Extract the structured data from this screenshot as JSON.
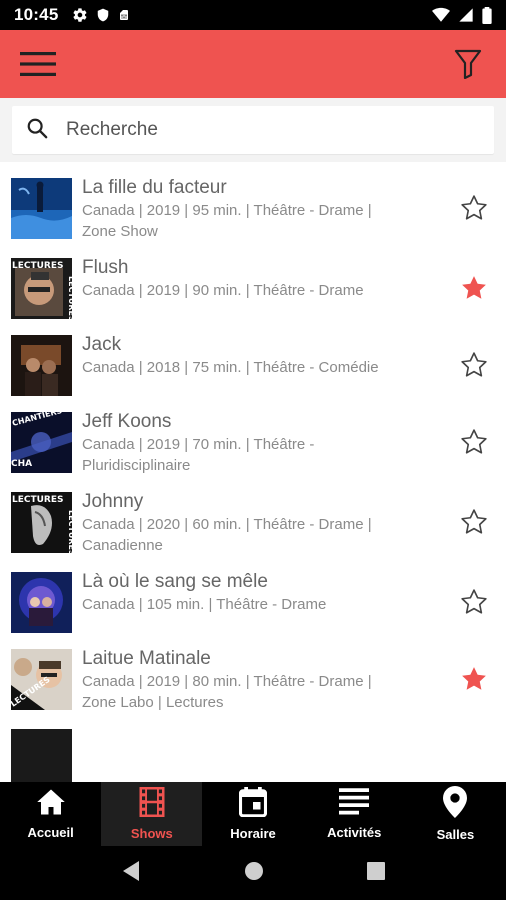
{
  "status_bar": {
    "time": "10:45",
    "left_icons": [
      "gear-icon",
      "shield-icon",
      "sim-card-icon"
    ],
    "right_icons": [
      "wifi-icon",
      "signal-icon",
      "battery-icon"
    ]
  },
  "app_bar": {
    "color": "#ef5350",
    "menu_icon": "hamburger-menu-icon",
    "filter_icon": "filter-icon"
  },
  "search": {
    "placeholder": "Recherche"
  },
  "shows": [
    {
      "title": "La fille du facteur",
      "meta_lines": [
        "Canada | 2019 | 95 min. | Théâtre - Drame |",
        "Zone Show"
      ],
      "favorite": false
    },
    {
      "title": "Flush",
      "meta_lines": [
        "Canada | 2019 | 90 min. | Théâtre - Drame"
      ],
      "favorite": true
    },
    {
      "title": "Jack",
      "meta_lines": [
        "Canada | 2018 | 75 min. | Théâtre - Comédie"
      ],
      "favorite": false
    },
    {
      "title": "Jeff Koons",
      "meta_lines": [
        "Canada | 2019 | 70 min. | Théâtre -",
        "Pluridisciplinaire"
      ],
      "favorite": false
    },
    {
      "title": "Johnny",
      "meta_lines": [
        "Canada | 2020 | 60 min. | Théâtre - Drame |",
        "Canadienne"
      ],
      "favorite": false
    },
    {
      "title": "Là où le sang se mêle",
      "meta_lines": [
        "Canada | 105 min. | Théâtre - Drame"
      ],
      "favorite": false
    },
    {
      "title": "Laitue Matinale",
      "meta_lines": [
        "Canada | 2019 | 80 min. | Théâtre - Drame |",
        "Zone Labo | Lectures"
      ],
      "favorite": true
    }
  ],
  "thumb_texts": {
    "lectures": "LECTURES",
    "chantiers": "CHANTIERS"
  },
  "bottom_nav": [
    {
      "label": "Accueil",
      "icon": "home-icon",
      "active": false
    },
    {
      "label": "Shows",
      "icon": "film-icon",
      "active": true
    },
    {
      "label": "Horaire",
      "icon": "calendar-icon",
      "active": false
    },
    {
      "label": "Activités",
      "icon": "list-icon",
      "active": false
    },
    {
      "label": "Salles",
      "icon": "location-pin-icon",
      "active": false
    }
  ],
  "system_nav": [
    "back-icon",
    "home-circle-icon",
    "recents-icon"
  ],
  "colors": {
    "accent": "#ef5350",
    "text_title": "#666666",
    "text_meta": "#8a8a8a"
  }
}
